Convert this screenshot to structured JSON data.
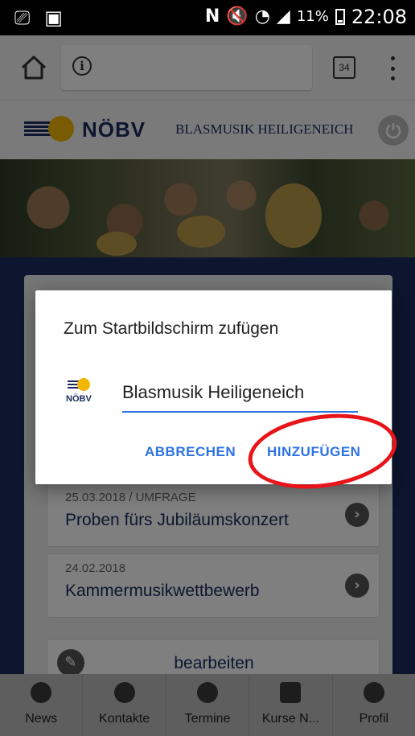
{
  "statusbar": {
    "left_icons": [
      "screenshot-icon",
      "gallery-icon"
    ],
    "right_icons": [
      "nfc-icon",
      "mute-icon",
      "wifi-icon",
      "signal-icon",
      "battery-icon"
    ],
    "battery": "11%",
    "time": "22:08"
  },
  "browser": {
    "tab_count": "34"
  },
  "site": {
    "logo_text": "NÖBV",
    "title": "BLASMUSIK HEILIGENEICH"
  },
  "news": [
    {
      "date": "25.03.2018 / UMFRAGE",
      "title": "Proben fürs Jubiläumskonzert"
    },
    {
      "date": "24.02.2018",
      "title": "Kammermusikwettbewerb"
    }
  ],
  "edit_label": "bearbeiten",
  "dialog": {
    "title": "Zum Startbildschirm zufügen",
    "logo_text": "NÖBV",
    "input_value": "Blasmusik Heiligeneich",
    "cancel_label": "ABBRECHEN",
    "add_label": "HINZUFÜGEN"
  },
  "bottom_nav": [
    {
      "label": "News",
      "icon": "news-icon"
    },
    {
      "label": "Kontakte",
      "icon": "contacts-icon"
    },
    {
      "label": "Termine",
      "icon": "calendar-list-icon"
    },
    {
      "label": "Kurse N...",
      "icon": "courses-icon"
    },
    {
      "label": "Profil",
      "icon": "profile-icon"
    }
  ],
  "colors": {
    "brand_navy": "#1a2a5e",
    "accent_blue": "#2d72e5",
    "annotation_red": "#e8141a"
  }
}
